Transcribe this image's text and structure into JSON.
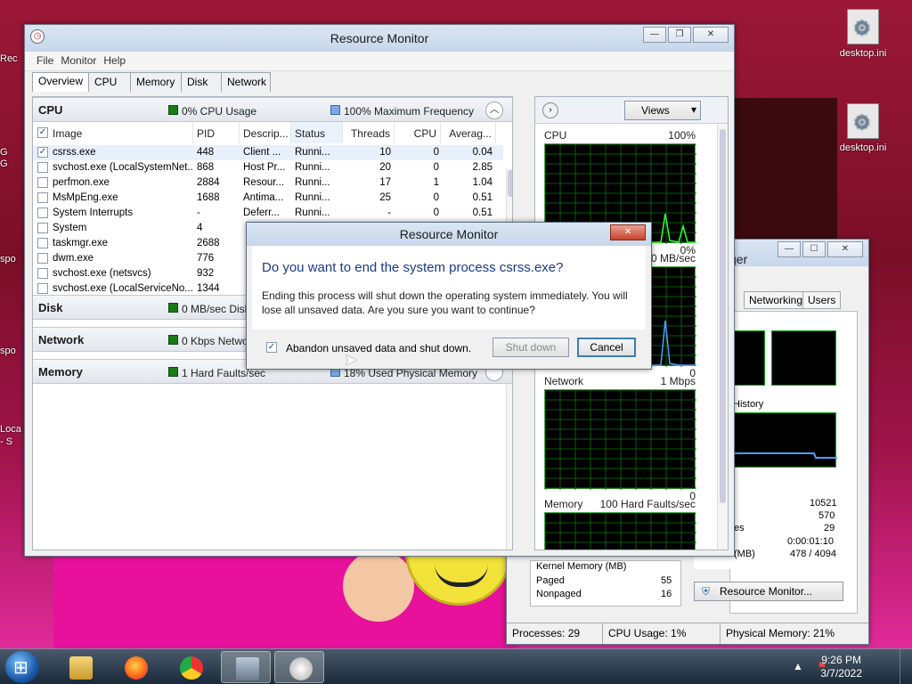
{
  "desktop": {
    "icons": [
      {
        "label": "desktop.ini"
      },
      {
        "label": "desktop.ini"
      }
    ],
    "left_stubs": [
      "Rec",
      "G",
      "G",
      "spo",
      "spo",
      "Loca",
      "- S"
    ]
  },
  "task_manager": {
    "title_fragment": "ger",
    "tabs": [
      "Networking",
      "Users"
    ],
    "history_label": "History",
    "stats": [
      "10521",
      "570",
      "29",
      "0:00:01:10",
      "478 / 4094"
    ],
    "stat_label_fragments": [
      "es",
      "(MB)"
    ],
    "kernel_memory": {
      "title": "Kernel Memory (MB)",
      "rows": [
        {
          "label": "Paged",
          "value": "55"
        },
        {
          "label": "Nonpaged",
          "value": "16"
        }
      ]
    },
    "resmon_button": "Resource Monitor...",
    "status": {
      "processes": "Processes: 29",
      "cpu": "CPU Usage: 1%",
      "memory": "Physical Memory: 21%"
    }
  },
  "resmon": {
    "title": "Resource Monitor",
    "menu": [
      "File",
      "Monitor",
      "Help"
    ],
    "tabs": [
      "Overview",
      "CPU",
      "Memory",
      "Disk",
      "Network"
    ],
    "cpu_section": {
      "title": "CPU",
      "usage": "0% CPU Usage",
      "freq": "100% Maximum Frequency",
      "columns": [
        "Image",
        "PID",
        "Descrip...",
        "Status",
        "Threads",
        "CPU",
        "Averag..."
      ],
      "rows": [
        {
          "image": "csrss.exe",
          "pid": "448",
          "desc": "Client ...",
          "status": "Runni...",
          "threads": "10",
          "cpu": "0",
          "avg": "0.04",
          "checked": true
        },
        {
          "image": "svchost.exe (LocalSystemNet...",
          "pid": "868",
          "desc": "Host Pr...",
          "status": "Runni...",
          "threads": "20",
          "cpu": "0",
          "avg": "2.85"
        },
        {
          "image": "perfmon.exe",
          "pid": "2884",
          "desc": "Resour...",
          "status": "Runni...",
          "threads": "17",
          "cpu": "1",
          "avg": "1.04"
        },
        {
          "image": "MsMpEng.exe",
          "pid": "1688",
          "desc": "Antima...",
          "status": "Runni...",
          "threads": "25",
          "cpu": "0",
          "avg": "0.51"
        },
        {
          "image": "System Interrupts",
          "pid": "-",
          "desc": "Deferr...",
          "status": "Runni...",
          "threads": "-",
          "cpu": "0",
          "avg": "0.51"
        },
        {
          "image": "System",
          "pid": "4",
          "desc": "",
          "status": "",
          "threads": "",
          "cpu": "",
          "avg": ""
        },
        {
          "image": "taskmgr.exe",
          "pid": "2688",
          "desc": "",
          "status": "",
          "threads": "",
          "cpu": "",
          "avg": ""
        },
        {
          "image": "dwm.exe",
          "pid": "776",
          "desc": "",
          "status": "",
          "threads": "",
          "cpu": "",
          "avg": ""
        },
        {
          "image": "svchost.exe (netsvcs)",
          "pid": "932",
          "desc": "",
          "status": "",
          "threads": "",
          "cpu": "",
          "avg": ""
        },
        {
          "image": "svchost.exe (LocalServiceNo...",
          "pid": "1344",
          "desc": "",
          "status": "",
          "threads": "",
          "cpu": "",
          "avg": ""
        }
      ]
    },
    "disk_section": {
      "title": "Disk",
      "ind1": "0 MB/sec Disk I/O"
    },
    "network_section": {
      "title": "Network",
      "ind1": "0 Kbps Network I/O"
    },
    "memory_section": {
      "title": "Memory",
      "ind1": "1 Hard Faults/sec",
      "ind2": "18% Used Physical Memory"
    },
    "right": {
      "views_label": "Views",
      "graphs": [
        {
          "name": "CPU",
          "max": "100%",
          "min": "0%"
        },
        {
          "name": "Disk",
          "max": "0 MB/sec",
          "min": "0"
        },
        {
          "name": "Network",
          "max": "1 Mbps",
          "min": "0"
        },
        {
          "name": "Memory",
          "max": "100 Hard Faults/sec",
          "min": ""
        }
      ]
    }
  },
  "dialog": {
    "title": "Resource Monitor",
    "question": "Do you want to end the system process csrss.exe?",
    "message": "Ending this process will shut down the operating system immediately. You will lose all unsaved data. Are you sure you want to continue?",
    "checkbox_label": "Abandon unsaved data and shut down.",
    "checkbox_checked": true,
    "shutdown_label": "Shut down",
    "cancel_label": "Cancel"
  },
  "taskbar": {
    "time": "9:26 PM",
    "date": "3/7/2022"
  }
}
